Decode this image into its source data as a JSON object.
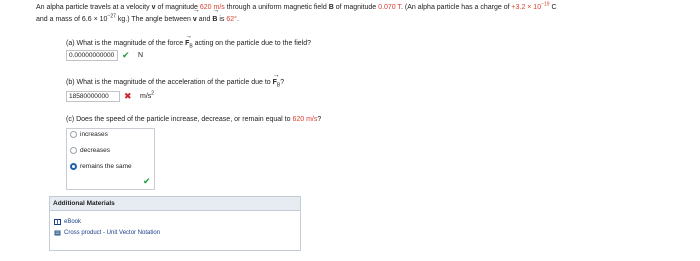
{
  "problem": {
    "t1": "An alpha particle travels at a velocity",
    "v": "v",
    "t2": "of magnitude",
    "speed": "620 m/s",
    "t3": "through a uniform magnetic field",
    "B": "B",
    "t4": "of magnitude",
    "field": "0.070 T",
    "t5": ". (An alpha particle has a charge of",
    "charge": "+3.2 × 10",
    "charge_exp": "−19",
    "charge_unit": "C",
    "t6": "and a mass of 6.6 × 10",
    "mass_exp": "−27",
    "t7": "kg.) The angle between",
    "t8": "and",
    "t9": "is",
    "angle": "62°",
    "t10": "."
  },
  "part_a": {
    "q1": "(a) What is the magnitude of the force",
    "F": "F",
    "sub": "B",
    "q2": "acting on the particle due to the field?",
    "answer": "0.00000000000",
    "status": "correct",
    "unit": "N"
  },
  "part_b": {
    "q1": "(b) What is the magnitude of the acceleration of the particle due to",
    "F": "F",
    "sub": "B",
    "q2": "?",
    "answer": "18580000000",
    "status": "incorrect",
    "unit": "m/s",
    "unit_exp": "2"
  },
  "part_c": {
    "q1": "(c) Does the speed of the particle increase, decrease, or remain equal to",
    "speed": "620 m/s",
    "q2": "?",
    "options": [
      "increases",
      "decreases",
      "remains the same"
    ],
    "selected": 2,
    "status": "correct"
  },
  "additional": {
    "title": "Additional Materials",
    "links": [
      "eBook",
      "Cross product - Unit Vector Notation"
    ]
  },
  "colors": {
    "highlight": "#d9412f",
    "correct": "#1a9b3c",
    "incorrect": "#cc2222",
    "link": "#1b3f8a"
  }
}
